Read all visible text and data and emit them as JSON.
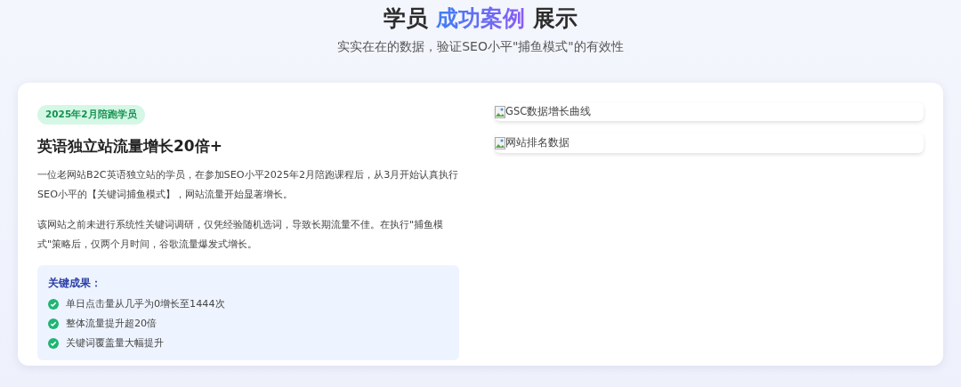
{
  "header": {
    "title_parts": [
      "学员 ",
      "成功案例",
      " 展示"
    ],
    "subtitle": "实实在在的数据，验证SEO小平\"捕鱼模式\"的有效性"
  },
  "case": {
    "badge": "2025年2月陪跑学员",
    "title": "英语独立站流量增长20倍+",
    "paragraphs": [
      "一位老网站B2C英语独立站的学员，在参加SEO小平2025年2月陪跑课程后，从3月开始认真执行SEO小平的【关键词捕鱼模式】，网站流量开始显著增长。",
      "该网站之前未进行系统性关键词调研，仅凭经验随机选词，导致长期流量不佳。在执行\"捕鱼模式\"策略后，仅两个月时间，谷歌流量爆发式增长。"
    ],
    "results": {
      "heading": "关键成果：",
      "items": [
        "单日点击量从几乎为0增长至1444次",
        "整体流量提升超20倍",
        "关键词覆盖量大幅提升"
      ]
    },
    "images": [
      {
        "alt": "GSC数据增长曲线"
      },
      {
        "alt": "网站排名数据"
      }
    ]
  }
}
